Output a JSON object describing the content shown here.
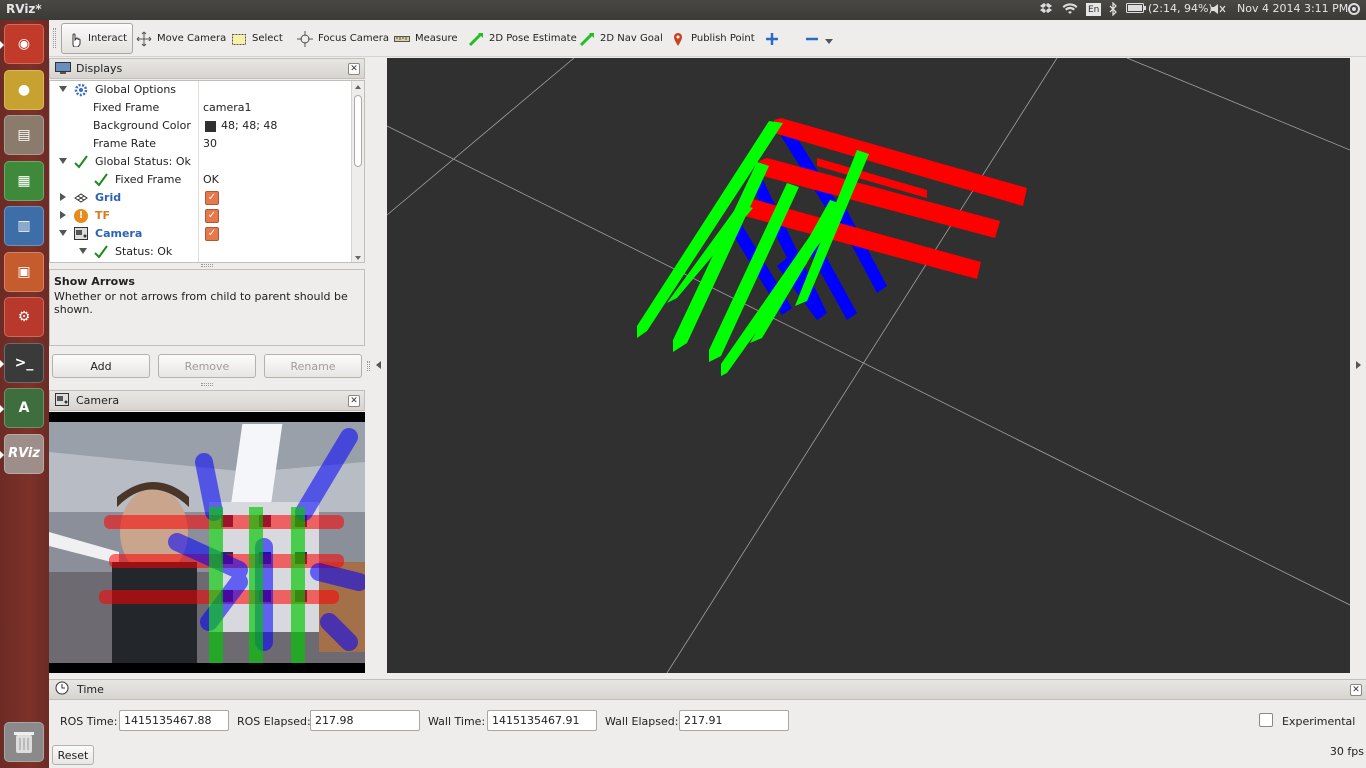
{
  "window": {
    "title": "RViz*"
  },
  "topbar": {
    "lang": "En",
    "battery": "(2:14, 94%)",
    "datetime": "Nov 4 2014  3:11 PM"
  },
  "launcher": {
    "items": [
      {
        "name": "dash-icon",
        "color": "#c13a2a"
      },
      {
        "name": "chrome-icon",
        "color": "#c7a231"
      },
      {
        "name": "files-icon",
        "color": "#8a7b6d"
      },
      {
        "name": "calc-icon",
        "color": "#3e8a3a"
      },
      {
        "name": "writer-icon",
        "color": "#3d6ea8"
      },
      {
        "name": "impress-icon",
        "color": "#c65b2e"
      },
      {
        "name": "settings-icon",
        "color": "#b8392b"
      },
      {
        "name": "terminal-icon",
        "color": "#3a3a3a"
      },
      {
        "name": "updater-icon",
        "color": "#3e6e3e"
      },
      {
        "name": "rviz-icon",
        "color": "#9e8e8a",
        "label": "RViz"
      }
    ],
    "trash_icon": "trash-icon"
  },
  "toolbar": {
    "interact": "Interact",
    "move_camera": "Move Camera",
    "select": "Select",
    "focus_camera": "Focus Camera",
    "measure": "Measure",
    "pose_estimate": "2D Pose Estimate",
    "nav_goal": "2D Nav Goal",
    "publish_point": "Publish Point"
  },
  "displays": {
    "title": "Displays",
    "rows": {
      "global_options": "Global Options",
      "fixed_frame_k": "Fixed Frame",
      "fixed_frame_v": "camera1",
      "bg_color_k": "Background Color",
      "bg_color_v": "48; 48; 48",
      "frame_rate_k": "Frame Rate",
      "frame_rate_v": "30",
      "global_status": "Global Status: Ok",
      "status_fixed_frame_k": "Fixed Frame",
      "status_fixed_frame_v": "OK",
      "grid": "Grid",
      "tf": "TF",
      "camera": "Camera",
      "camera_status": "Status: Ok"
    },
    "bg_color_hex": "#303030",
    "desc_title": "Show Arrows",
    "desc_text": "Whether or not arrows from child to parent should be shown.",
    "add": "Add",
    "remove": "Remove",
    "rename": "Rename"
  },
  "camera_panel": {
    "title": "Camera"
  },
  "time": {
    "title": "Time",
    "ros_time_label": "ROS Time:",
    "ros_time": "1415135467.88",
    "ros_elapsed_label": "ROS Elapsed:",
    "ros_elapsed": "217.98",
    "wall_time_label": "Wall Time:",
    "wall_time": "1415135467.91",
    "wall_elapsed_label": "Wall Elapsed:",
    "wall_elapsed": "217.91",
    "experimental": "Experimental",
    "reset": "Reset",
    "fps": "30 fps"
  },
  "colors": {
    "x_axis": "#ff0000",
    "y_axis": "#00ff00",
    "z_axis": "#0000ff",
    "tf_orange": "#d97b1e",
    "grid_blue": "#2a62b8"
  }
}
